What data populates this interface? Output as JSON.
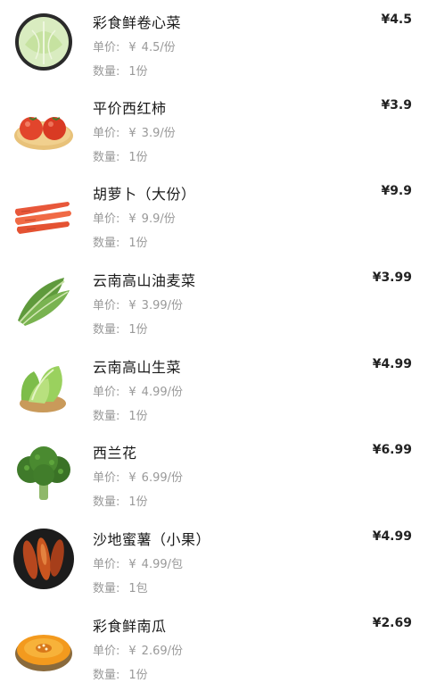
{
  "order": {
    "labels": {
      "unit_price": "单价:",
      "quantity": "数量:"
    },
    "currency": "¥",
    "items": [
      {
        "name": "彩食鲜卷心菜",
        "price": "¥4.5",
        "unit_price": "4.5/份",
        "quantity": "1份",
        "icon": "cabbage-icon"
      },
      {
        "name": "平价西红柿",
        "price": "¥3.9",
        "unit_price": "3.9/份",
        "quantity": "1份",
        "icon": "tomato-icon"
      },
      {
        "name": "胡萝卜（大份）",
        "price": "¥9.9",
        "unit_price": "9.9/份",
        "quantity": "1份",
        "icon": "carrot-icon"
      },
      {
        "name": "云南高山油麦菜",
        "price": "¥3.99",
        "unit_price": "3.99/份",
        "quantity": "1份",
        "icon": "lettuce-leaf-icon"
      },
      {
        "name": "云南高山生菜",
        "price": "¥4.99",
        "unit_price": "4.99/份",
        "quantity": "1份",
        "icon": "lettuce-icon"
      },
      {
        "name": "西兰花",
        "price": "¥6.99",
        "unit_price": "6.99/份",
        "quantity": "1份",
        "icon": "broccoli-icon"
      },
      {
        "name": "沙地蜜薯（小果）",
        "price": "¥4.99",
        "unit_price": "4.99/包",
        "quantity": "1包",
        "icon": "sweet-potato-icon"
      },
      {
        "name": "彩食鲜南瓜",
        "price": "¥2.69",
        "unit_price": "2.69/份",
        "quantity": "1份",
        "icon": "pumpkin-icon"
      }
    ]
  }
}
